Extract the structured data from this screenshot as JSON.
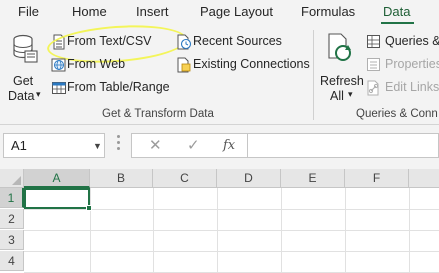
{
  "tabs": [
    {
      "label": "File"
    },
    {
      "label": "Home"
    },
    {
      "label": "Insert"
    },
    {
      "label": "Page Layout"
    },
    {
      "label": "Formulas"
    },
    {
      "label": "Data"
    }
  ],
  "active_tab": "Data",
  "ribbon": {
    "get_data": {
      "line1": "Get",
      "line2": "Data",
      "arrow": "▾"
    },
    "from_text_csv": "From Text/CSV",
    "from_web": "From Web",
    "from_table_range": "From Table/Range",
    "recent_sources": "Recent Sources",
    "existing_connections": "Existing Connections",
    "group_get_transform": "Get & Transform Data",
    "refresh": {
      "line1": "Refresh",
      "line2": "All",
      "arrow": "▾"
    },
    "queries": "Queries &",
    "properties": "Properties",
    "edit_links": "Edit Links",
    "group_queries": "Queries & Conn"
  },
  "formula_bar": {
    "name_box": "A1",
    "cancel": "✕",
    "enter": "✓",
    "fx": "fx",
    "formula": ""
  },
  "grid": {
    "columns": [
      "A",
      "B",
      "C",
      "D",
      "E",
      "F"
    ],
    "rows": [
      "1",
      "2",
      "3",
      "4"
    ],
    "selected_cell": "A1"
  },
  "colors": {
    "accent": "#217346",
    "ribbon_bg": "#f3f3f3",
    "highlight": "#f3f55a"
  }
}
